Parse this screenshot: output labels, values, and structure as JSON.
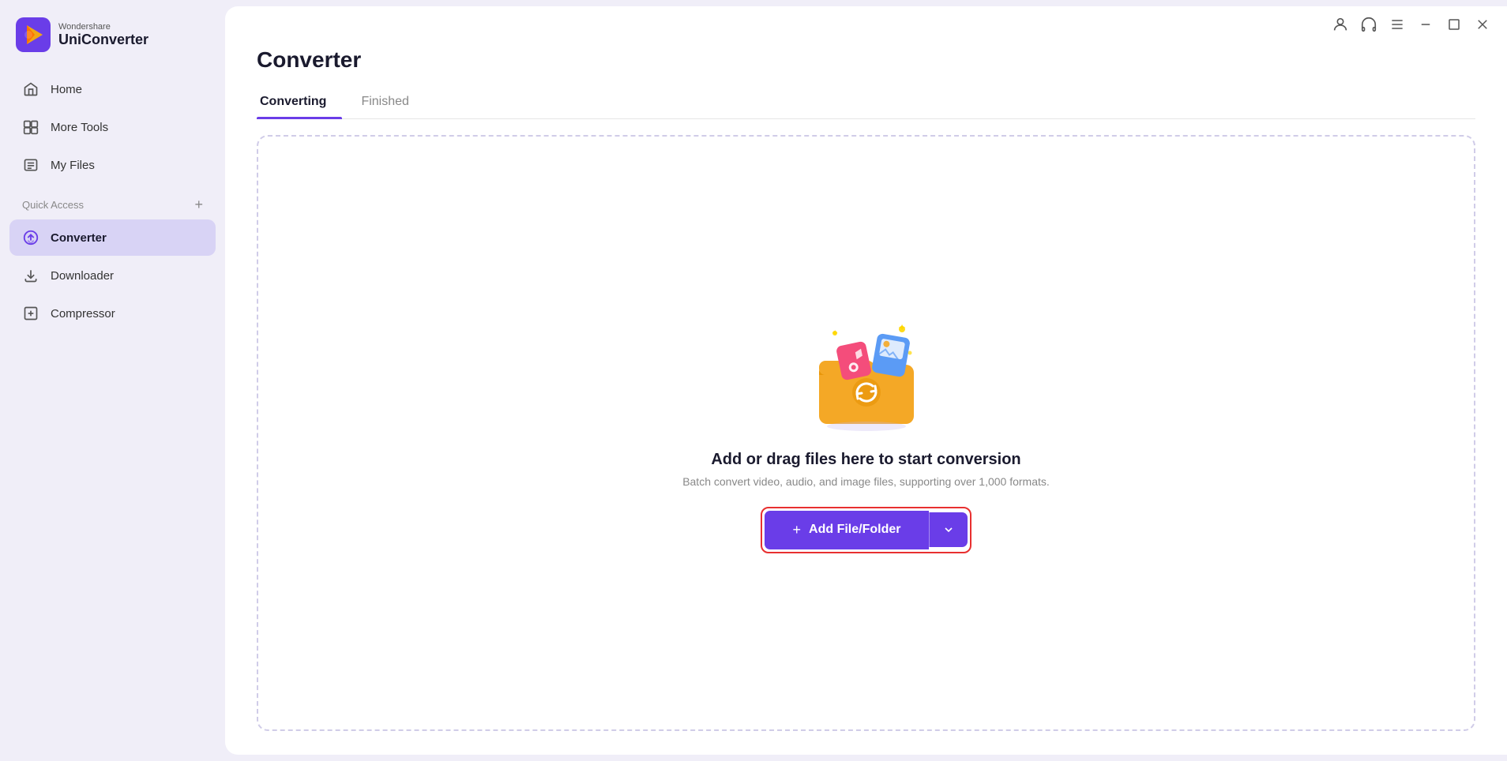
{
  "app": {
    "name_top": "Wondershare",
    "name_bottom": "UniConverter"
  },
  "titlebar": {
    "icons": [
      "user",
      "headset",
      "menu",
      "minimize",
      "maximize",
      "close"
    ]
  },
  "sidebar": {
    "nav_items": [
      {
        "id": "home",
        "label": "Home",
        "icon": "home"
      },
      {
        "id": "more-tools",
        "label": "More Tools",
        "icon": "more-tools"
      },
      {
        "id": "my-files",
        "label": "My Files",
        "icon": "my-files"
      }
    ],
    "quick_access_label": "Quick Access",
    "quick_access_items": [
      {
        "id": "converter",
        "label": "Converter",
        "icon": "converter",
        "active": true
      },
      {
        "id": "downloader",
        "label": "Downloader",
        "icon": "downloader"
      },
      {
        "id": "compressor",
        "label": "Compressor",
        "icon": "compressor"
      }
    ]
  },
  "main": {
    "page_title": "Converter",
    "tabs": [
      {
        "id": "converting",
        "label": "Converting",
        "active": true
      },
      {
        "id": "finished",
        "label": "Finished",
        "active": false
      }
    ],
    "drop_zone": {
      "main_text": "Add or drag files here to start conversion",
      "sub_text": "Batch convert video, audio, and image files, supporting over 1,000 formats.",
      "button_label": "Add File/Folder",
      "button_plus": "+"
    }
  }
}
